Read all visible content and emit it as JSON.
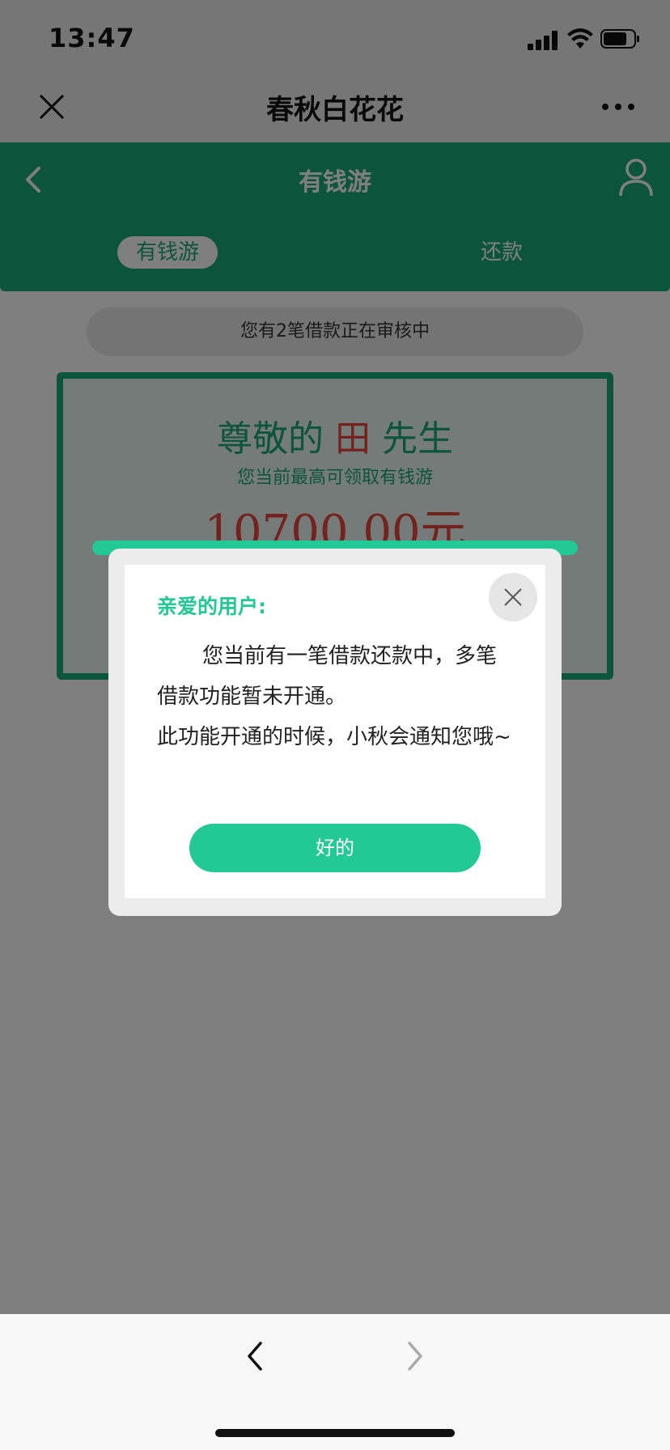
{
  "status_bar": {
    "time": "13:47"
  },
  "wechat_header": {
    "title": "春秋白花花"
  },
  "app_header": {
    "title": "有钱游",
    "tabs": [
      {
        "label": "有钱游",
        "active": true
      },
      {
        "label": "还款",
        "active": false
      }
    ]
  },
  "notice": "您有2笔借款正在审核中",
  "card": {
    "greeting_prefix": "尊敬的 ",
    "name": "田",
    "greeting_suffix": " 先生",
    "subtitle": "您当前最高可领取有钱游",
    "amount": "10700.00元"
  },
  "modal": {
    "heading": "亲爱的用户:",
    "body_line1": "您当前有一笔借款还款中，多笔借款功能暂未开通。",
    "body_line2": "此功能开通的时候，小秋会通知您哦~",
    "ok_label": "好的"
  },
  "colors": {
    "brand_green": "#1aa978",
    "modal_green": "#22c994",
    "highlight_red": "#e8453c"
  }
}
